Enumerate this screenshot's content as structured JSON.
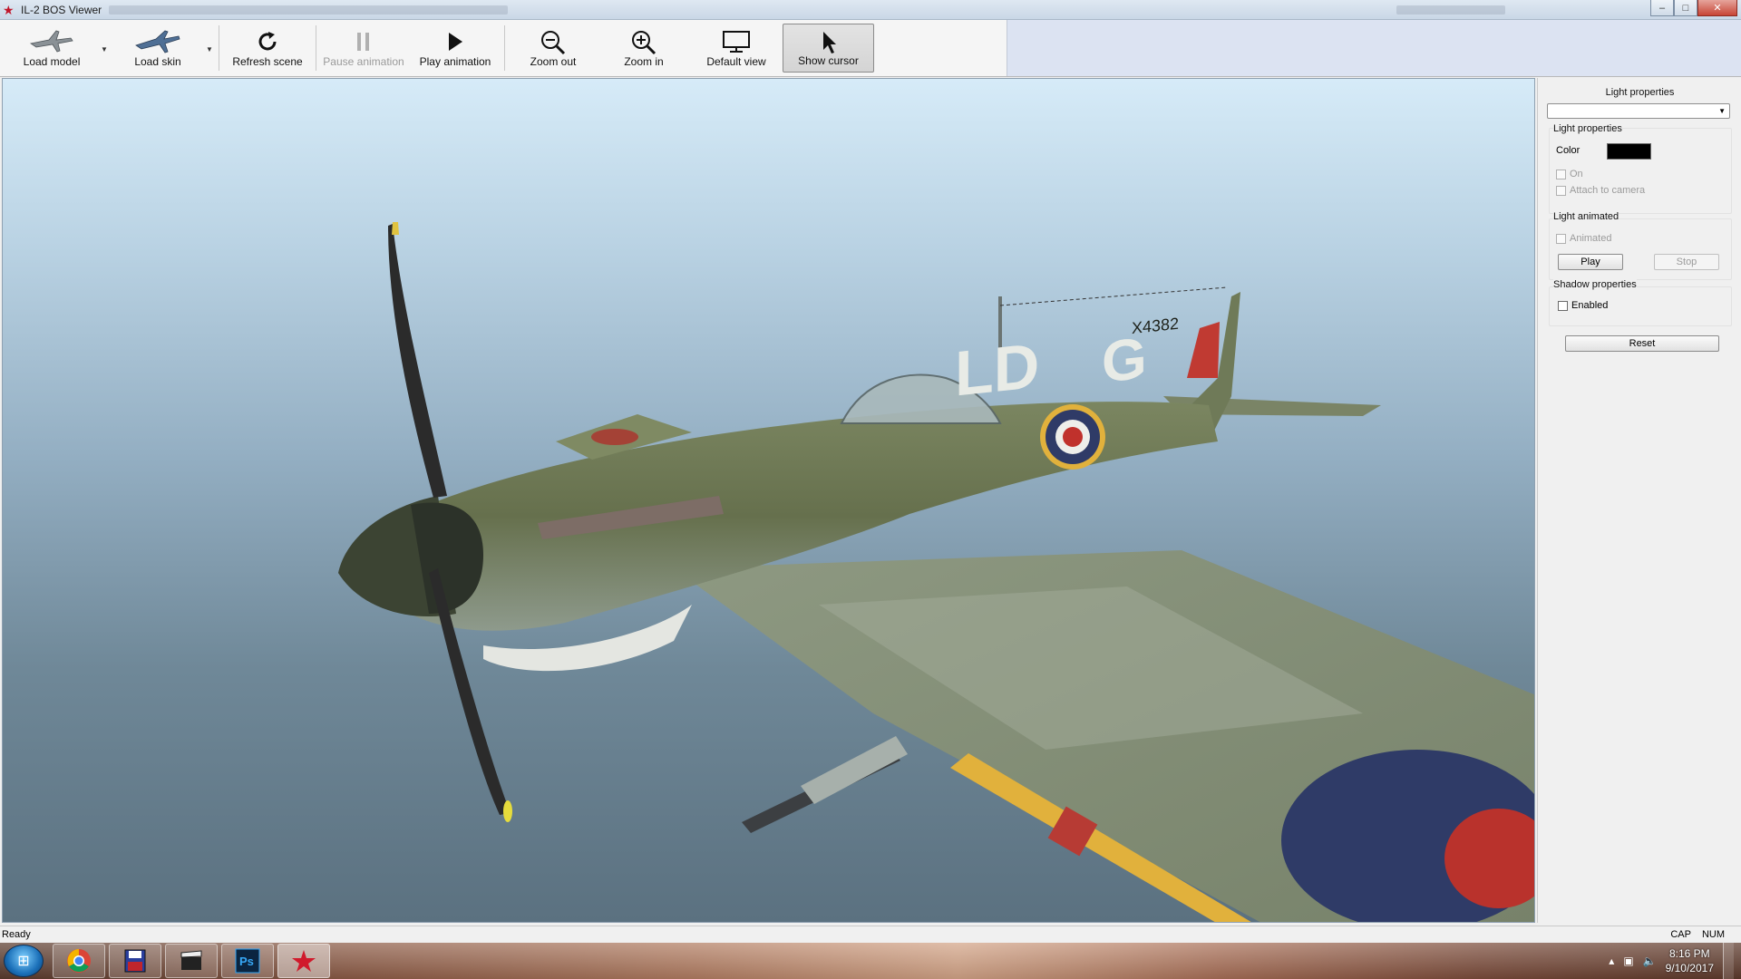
{
  "window": {
    "title": "IL-2 BOS Viewer",
    "controls": {
      "minimize": "–",
      "maximize": "□",
      "close": "✕"
    }
  },
  "toolbar": {
    "items": [
      {
        "label": "Load model",
        "icon": "airplane-model-icon",
        "enabled": true
      },
      {
        "label": "Load skin",
        "icon": "airplane-skin-icon",
        "enabled": true
      },
      {
        "label": "Refresh scene",
        "icon": "refresh-icon",
        "enabled": true
      },
      {
        "label": "Pause animation",
        "icon": "pause-icon",
        "enabled": false
      },
      {
        "label": "Play animation",
        "icon": "play-icon",
        "enabled": true
      },
      {
        "label": "Zoom out",
        "icon": "zoom-out-icon",
        "enabled": true
      },
      {
        "label": "Zoom in",
        "icon": "zoom-in-icon",
        "enabled": true
      },
      {
        "label": "Default view",
        "icon": "monitor-icon",
        "enabled": true
      },
      {
        "label": "Show cursor",
        "icon": "cursor-icon",
        "enabled": true,
        "pressed": true
      }
    ]
  },
  "viewport": {
    "aircraft": {
      "code_left": "LD",
      "code_right": "G",
      "serial": "X4382"
    }
  },
  "panel": {
    "title": "Light properties",
    "select_value": "",
    "light_group": {
      "title": "Light properties",
      "color_label": "Color",
      "color_value": "#000000",
      "on_label": "On",
      "attach_label": "Attach to camera"
    },
    "animated_group": {
      "title": "Light animated",
      "animated_label": "Animated",
      "play_label": "Play",
      "stop_label": "Stop"
    },
    "shadow_group": {
      "title": "Shadow properties",
      "enabled_label": "Enabled"
    },
    "reset_label": "Reset"
  },
  "statusbar": {
    "status": "Ready",
    "caps": "CAP",
    "num": "NUM"
  },
  "taskbar": {
    "apps": [
      "chrome-icon",
      "save-disk-icon",
      "film-clapper-icon",
      "photoshop-icon",
      "il2-viewer-icon"
    ],
    "photoshop_label": "Ps",
    "clock_time": "8:16 PM",
    "clock_date": "9/10/2017"
  }
}
